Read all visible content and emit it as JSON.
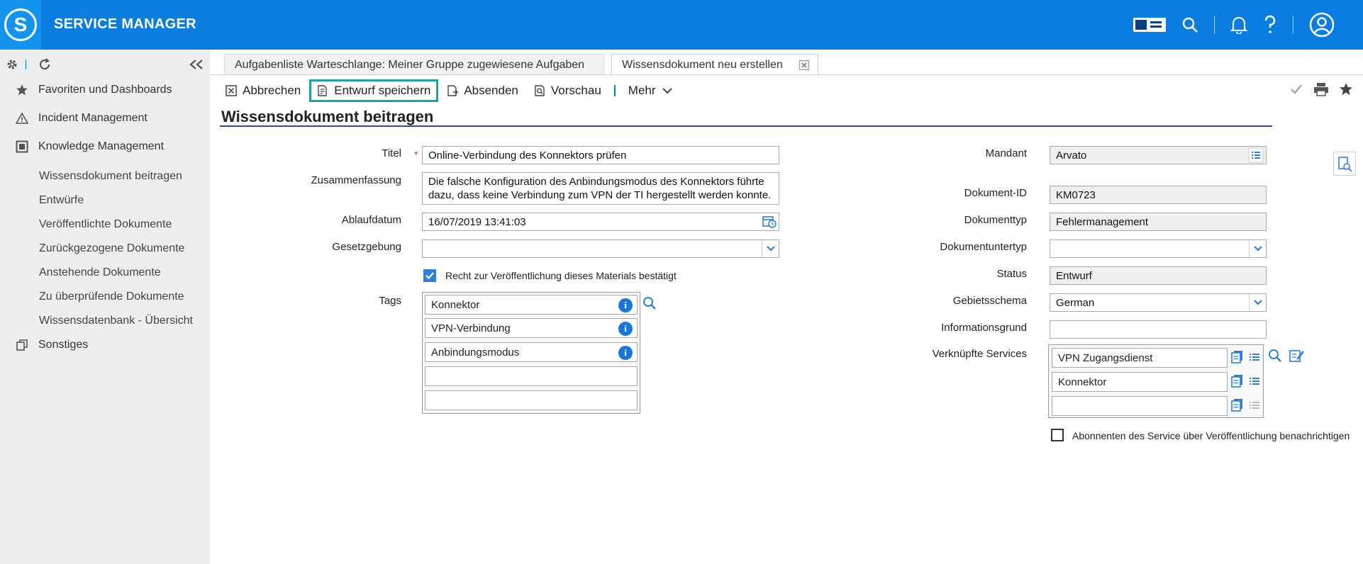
{
  "app": {
    "title": "SERVICE MANAGER",
    "logo_letter": "S"
  },
  "header_icons": [
    "panel-icon",
    "search-icon",
    "bell-icon",
    "help-icon",
    "user-icon"
  ],
  "sidebar": {
    "items": [
      {
        "label": "Favoriten und Dashboards",
        "icon": "star-icon"
      },
      {
        "label": "Incident Management",
        "icon": "warning-icon"
      },
      {
        "label": "Knowledge Management",
        "icon": "square-icon"
      },
      {
        "label": "Sonstiges",
        "icon": "copy-icon"
      }
    ],
    "subitems": [
      "Wissensdokument beitragen",
      "Entwürfe",
      "Veröffentlichte Dokumente",
      "Zurückgezogene Dokumente",
      "Anstehende Dokumente",
      "Zu überprüfende Dokumente",
      "Wissensdatenbank - Übersicht"
    ]
  },
  "tabs": [
    {
      "label": "Aufgabenliste Warteschlange: Meiner Gruppe zugewiesene Aufgaben",
      "active": false
    },
    {
      "label": "Wissensdokument neu erstellen",
      "active": true
    }
  ],
  "toolbar": {
    "cancel": "Abbrechen",
    "save_draft": "Entwurf speichern",
    "submit": "Absenden",
    "preview": "Vorschau",
    "more": "Mehr"
  },
  "page_title": "Wissensdokument beitragen",
  "form_left": {
    "title_label": "Titel",
    "title_value": "Online-Verbindung des Konnektors prüfen",
    "summary_label": "Zusammenfassung",
    "summary_value": "Die falsche Konfiguration des Anbindungsmodus des Konnektors führte dazu, dass keine Verbindung zum VPN der TI hergestellt werden konnte.",
    "expiry_label": "Ablaufdatum",
    "expiry_value": "16/07/2019 13:41:03",
    "law_label": "Gesetzgebung",
    "law_value": "",
    "rights_label": "Recht zur Veröffentlichung dieses Materials bestätigt",
    "rights_checked": true,
    "tags_label": "Tags",
    "tags": [
      "Konnektor",
      "VPN-Verbindung",
      "Anbindungsmodus",
      "",
      ""
    ]
  },
  "form_right": {
    "client_label": "Mandant",
    "client_value": "Arvato",
    "docid_label": "Dokument-ID",
    "docid_value": "KM0723",
    "doctype_label": "Dokumenttyp",
    "doctype_value": "Fehlermanagement",
    "subtype_label": "Dokumentuntertyp",
    "subtype_value": "",
    "status_label": "Status",
    "status_value": "Entwurf",
    "locale_label": "Gebietsschema",
    "locale_value": "German",
    "reason_label": "Informationsgrund",
    "reason_value": "",
    "services_label": "Verknüpfte Services",
    "services": [
      "VPN Zugangsdienst",
      "Konnektor",
      ""
    ],
    "notify_label": "Abonnenten des Service über Veröffentlichung benachrichtigen",
    "notify_checked": false
  },
  "colors": {
    "header": "#0a7de0",
    "highlight": "#1da3a3",
    "rule": "#2a4a9a"
  }
}
